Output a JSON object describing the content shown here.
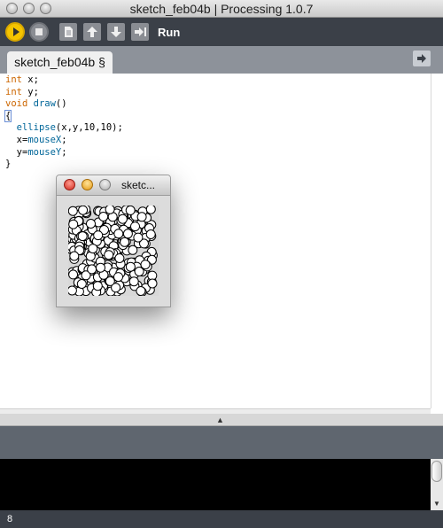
{
  "window": {
    "title": "sketch_feb04b | Processing 1.0.7"
  },
  "toolbar": {
    "run_label": "Run",
    "buttons": [
      "run-icon",
      "stop-icon",
      "new-icon",
      "open-icon",
      "save-icon",
      "export-icon"
    ],
    "accent": "#f5c400"
  },
  "tabs": [
    {
      "label": "sketch_feb04b §"
    }
  ],
  "editor": {
    "lines": [
      "int x;",
      "int y;",
      "void draw()",
      "{",
      "  ellipse(x,y,10,10);",
      "  x=mouseX;",
      "  y=mouseY;",
      "}"
    ]
  },
  "sketch_window": {
    "title": "sketc..."
  },
  "status": {
    "line_number": "8"
  }
}
